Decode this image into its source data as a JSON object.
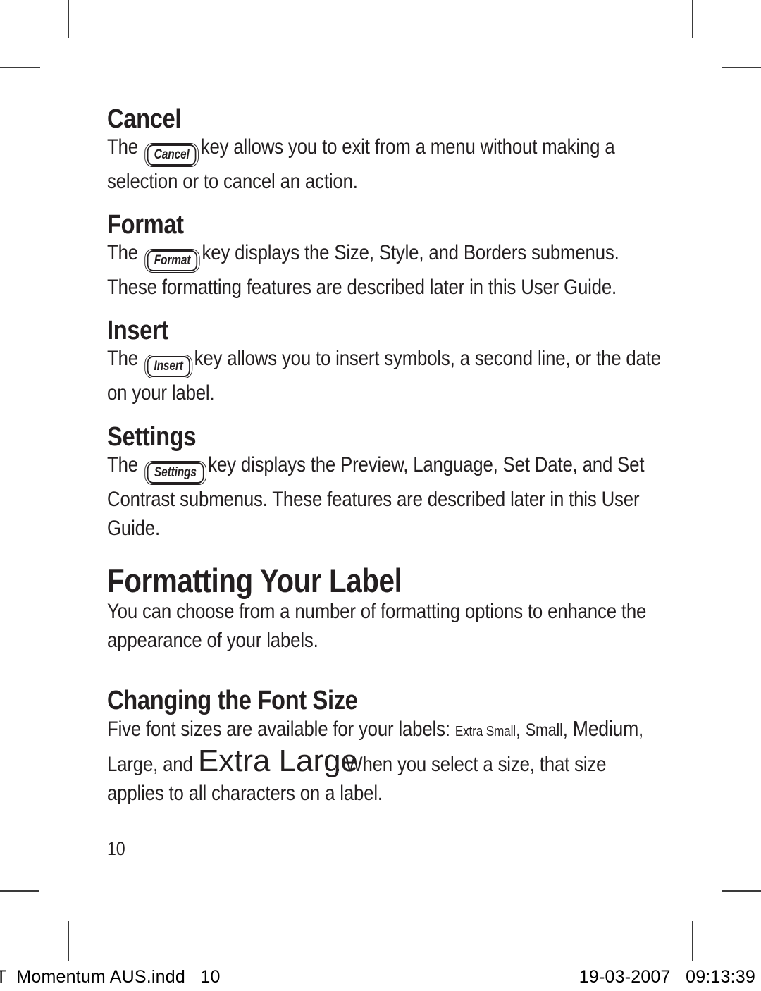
{
  "document": {
    "page_number": "10",
    "sections": [
      {
        "id": "cancel",
        "heading": "Cancel",
        "key_label": "Cancel",
        "text_before_key": "The ",
        "text_after_key": "key allows you to exit from a menu without making a selection or to cancel an action."
      },
      {
        "id": "format",
        "heading": "Format",
        "key_label": "Format",
        "text_before_key": "The ",
        "text_after_key": "key displays the Size, Style, and Borders submenus. These formatting features are described later in this User Guide."
      },
      {
        "id": "insert",
        "heading": "Insert",
        "key_label": "Insert",
        "text_before_key": "The ",
        "text_after_key": "key allows you to insert symbols, a second line, or the date on your label."
      },
      {
        "id": "settings",
        "heading": "Settings",
        "key_label": "Settings",
        "text_before_key": "The ",
        "text_after_key": "key displays the Preview, Language, Set Date, and Set Contrast submenus. These features are described later in this User Guide."
      }
    ],
    "formatting_your_label": {
      "heading": "Formatting Your Label",
      "body": "You can choose from a number of formatting options to enhance the appearance of your labels."
    },
    "changing_font_size": {
      "heading": "Changing the Font Size",
      "intro": "Five font sizes are available for your labels: ",
      "sizes": {
        "extra_small": "Extra Small",
        "comma_1": ", ",
        "small": "Small",
        "comma_2": ", ",
        "medium": "Medium",
        "comma_3": ", ",
        "large": "Large",
        "and": ", and ",
        "extra_large": "Extra Large"
      },
      "outro": ". When you select a size, that size applies to all characters on a label."
    }
  },
  "slug": {
    "left": "T  Momentum AUS.indd   10",
    "right": "19-03-2007   09:13:39"
  },
  "colors": {
    "text": "#231f20",
    "crop_mark": "#3a3a3a",
    "slug_text": "#000000",
    "background": "#ffffff"
  }
}
